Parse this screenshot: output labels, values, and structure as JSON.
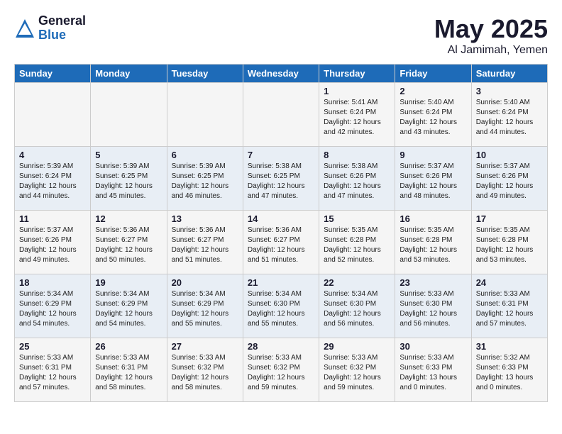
{
  "header": {
    "logo_general": "General",
    "logo_blue": "Blue",
    "title": "May 2025",
    "location": "Al Jamimah, Yemen"
  },
  "days_of_week": [
    "Sunday",
    "Monday",
    "Tuesday",
    "Wednesday",
    "Thursday",
    "Friday",
    "Saturday"
  ],
  "weeks": [
    [
      {
        "day": "",
        "info": ""
      },
      {
        "day": "",
        "info": ""
      },
      {
        "day": "",
        "info": ""
      },
      {
        "day": "",
        "info": ""
      },
      {
        "day": "1",
        "info": "Sunrise: 5:41 AM\nSunset: 6:24 PM\nDaylight: 12 hours\nand 42 minutes."
      },
      {
        "day": "2",
        "info": "Sunrise: 5:40 AM\nSunset: 6:24 PM\nDaylight: 12 hours\nand 43 minutes."
      },
      {
        "day": "3",
        "info": "Sunrise: 5:40 AM\nSunset: 6:24 PM\nDaylight: 12 hours\nand 44 minutes."
      }
    ],
    [
      {
        "day": "4",
        "info": "Sunrise: 5:39 AM\nSunset: 6:24 PM\nDaylight: 12 hours\nand 44 minutes."
      },
      {
        "day": "5",
        "info": "Sunrise: 5:39 AM\nSunset: 6:25 PM\nDaylight: 12 hours\nand 45 minutes."
      },
      {
        "day": "6",
        "info": "Sunrise: 5:39 AM\nSunset: 6:25 PM\nDaylight: 12 hours\nand 46 minutes."
      },
      {
        "day": "7",
        "info": "Sunrise: 5:38 AM\nSunset: 6:25 PM\nDaylight: 12 hours\nand 47 minutes."
      },
      {
        "day": "8",
        "info": "Sunrise: 5:38 AM\nSunset: 6:26 PM\nDaylight: 12 hours\nand 47 minutes."
      },
      {
        "day": "9",
        "info": "Sunrise: 5:37 AM\nSunset: 6:26 PM\nDaylight: 12 hours\nand 48 minutes."
      },
      {
        "day": "10",
        "info": "Sunrise: 5:37 AM\nSunset: 6:26 PM\nDaylight: 12 hours\nand 49 minutes."
      }
    ],
    [
      {
        "day": "11",
        "info": "Sunrise: 5:37 AM\nSunset: 6:26 PM\nDaylight: 12 hours\nand 49 minutes."
      },
      {
        "day": "12",
        "info": "Sunrise: 5:36 AM\nSunset: 6:27 PM\nDaylight: 12 hours\nand 50 minutes."
      },
      {
        "day": "13",
        "info": "Sunrise: 5:36 AM\nSunset: 6:27 PM\nDaylight: 12 hours\nand 51 minutes."
      },
      {
        "day": "14",
        "info": "Sunrise: 5:36 AM\nSunset: 6:27 PM\nDaylight: 12 hours\nand 51 minutes."
      },
      {
        "day": "15",
        "info": "Sunrise: 5:35 AM\nSunset: 6:28 PM\nDaylight: 12 hours\nand 52 minutes."
      },
      {
        "day": "16",
        "info": "Sunrise: 5:35 AM\nSunset: 6:28 PM\nDaylight: 12 hours\nand 53 minutes."
      },
      {
        "day": "17",
        "info": "Sunrise: 5:35 AM\nSunset: 6:28 PM\nDaylight: 12 hours\nand 53 minutes."
      }
    ],
    [
      {
        "day": "18",
        "info": "Sunrise: 5:34 AM\nSunset: 6:29 PM\nDaylight: 12 hours\nand 54 minutes."
      },
      {
        "day": "19",
        "info": "Sunrise: 5:34 AM\nSunset: 6:29 PM\nDaylight: 12 hours\nand 54 minutes."
      },
      {
        "day": "20",
        "info": "Sunrise: 5:34 AM\nSunset: 6:29 PM\nDaylight: 12 hours\nand 55 minutes."
      },
      {
        "day": "21",
        "info": "Sunrise: 5:34 AM\nSunset: 6:30 PM\nDaylight: 12 hours\nand 55 minutes."
      },
      {
        "day": "22",
        "info": "Sunrise: 5:34 AM\nSunset: 6:30 PM\nDaylight: 12 hours\nand 56 minutes."
      },
      {
        "day": "23",
        "info": "Sunrise: 5:33 AM\nSunset: 6:30 PM\nDaylight: 12 hours\nand 56 minutes."
      },
      {
        "day": "24",
        "info": "Sunrise: 5:33 AM\nSunset: 6:31 PM\nDaylight: 12 hours\nand 57 minutes."
      }
    ],
    [
      {
        "day": "25",
        "info": "Sunrise: 5:33 AM\nSunset: 6:31 PM\nDaylight: 12 hours\nand 57 minutes."
      },
      {
        "day": "26",
        "info": "Sunrise: 5:33 AM\nSunset: 6:31 PM\nDaylight: 12 hours\nand 58 minutes."
      },
      {
        "day": "27",
        "info": "Sunrise: 5:33 AM\nSunset: 6:32 PM\nDaylight: 12 hours\nand 58 minutes."
      },
      {
        "day": "28",
        "info": "Sunrise: 5:33 AM\nSunset: 6:32 PM\nDaylight: 12 hours\nand 59 minutes."
      },
      {
        "day": "29",
        "info": "Sunrise: 5:33 AM\nSunset: 6:32 PM\nDaylight: 12 hours\nand 59 minutes."
      },
      {
        "day": "30",
        "info": "Sunrise: 5:33 AM\nSunset: 6:33 PM\nDaylight: 13 hours\nand 0 minutes."
      },
      {
        "day": "31",
        "info": "Sunrise: 5:32 AM\nSunset: 6:33 PM\nDaylight: 13 hours\nand 0 minutes."
      }
    ]
  ]
}
